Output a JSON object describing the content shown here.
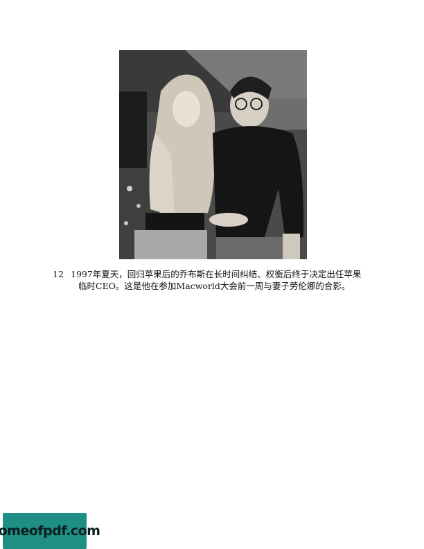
{
  "photo": {
    "description_icon": "portrait-photo-icon"
  },
  "caption": {
    "number": "12",
    "line1": "1997年夏天，回归苹果后的乔布斯在长时间纠结、权衡后终于决定出任苹果",
    "line2": "临时CEO。这是他在参加Macworld大会前一周与妻子劳伦娜的合影。"
  },
  "watermark": {
    "text": "homeofpdf.com",
    "color": "#1f8f86"
  }
}
